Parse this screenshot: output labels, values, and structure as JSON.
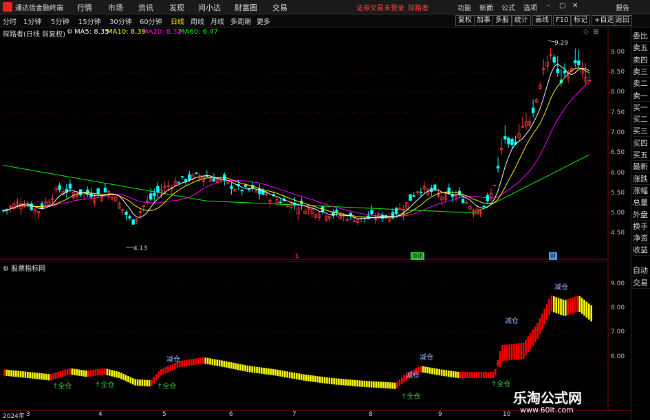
{
  "app": {
    "name": "通达信金融终端",
    "menu": [
      "行情",
      "市场",
      "资讯",
      "发现",
      "问小达",
      "财富圈",
      "交易"
    ],
    "warning": "证券交易未登录",
    "warning_user": "探路者",
    "right_menu": [
      "功能",
      "新面",
      "公式",
      "选项"
    ],
    "right_extra": "报告"
  },
  "toolbar": {
    "periods": [
      "分时",
      "1分钟",
      "5分钟",
      "15分钟",
      "30分钟",
      "60分钟",
      "日线",
      "周线",
      "月线",
      "多周期",
      "更多"
    ],
    "active_period": "日线",
    "right_buttons": [
      "复权",
      "加事",
      "多股",
      "统计",
      "画线",
      "F10",
      "标记",
      "+自选",
      "返回"
    ]
  },
  "main_chart": {
    "stock_label": "探路者(日线 前复权)",
    "ma": [
      {
        "label": "MA5: 8.35",
        "color": "#ffffff"
      },
      {
        "label": "MA10: 8.39",
        "color": "#ffff00"
      },
      {
        "label": "MA20: 8.32",
        "color": "#ff00ff"
      },
      {
        "label": "MA60: 6.47",
        "color": "#00ff00"
      }
    ],
    "y_ticks": [
      "9.00",
      "8.50",
      "8.00",
      "7.50",
      "7.00",
      "6.50",
      "6.00",
      "5.50",
      "5.00",
      "4.50"
    ],
    "high_label": "9.29",
    "low_label": "4.13",
    "event_markers": [
      "$",
      "资讯",
      "财"
    ]
  },
  "sub_chart": {
    "label": "股票指标网",
    "y_ticks": [
      "9.00",
      "8.00",
      "7.00",
      "6.00"
    ],
    "signals": [
      "全仓",
      "全仓",
      "全仓",
      "减仓",
      "全仓",
      "减仓",
      "减仓",
      "全仓",
      "减仓",
      "减仓"
    ]
  },
  "x_axis": [
    "2024年",
    "3",
    "4",
    "5",
    "6",
    "7",
    "8",
    "9",
    "10"
  ],
  "right_panel": [
    "委比",
    "卖五",
    "卖四",
    "卖三",
    "卖二",
    "卖一",
    "买一",
    "买二",
    "买三",
    "买四",
    "买五",
    "最新",
    "涨跌",
    "涨幅",
    "总量",
    "外盘",
    "换手",
    "净资",
    "收益",
    "自动",
    "交易"
  ],
  "watermark": {
    "title": "乐淘公式网",
    "url": "www.60lt.com"
  },
  "colors": {
    "up": "#ff3b3b",
    "down": "#00ffff",
    "ma5": "#ffffff",
    "ma10": "#ffff00",
    "ma20": "#ff00ff",
    "ma60": "#00ff00",
    "grid": "#8b0000",
    "bar_up": "#ff0000",
    "bar_down": "#ffff00"
  }
}
